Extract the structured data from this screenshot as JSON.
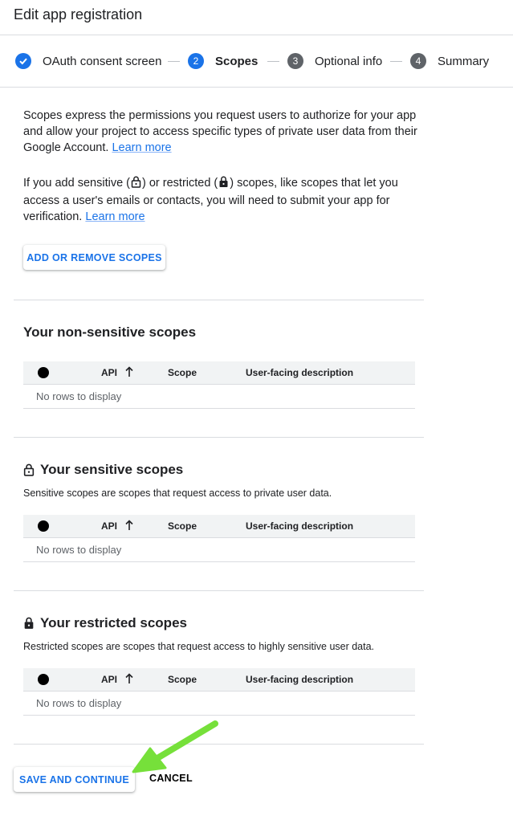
{
  "header": {
    "title": "Edit app registration"
  },
  "stepper": {
    "steps": [
      {
        "number": "",
        "label": "OAuth consent screen",
        "state": "done"
      },
      {
        "number": "2",
        "label": "Scopes",
        "state": "active"
      },
      {
        "number": "3",
        "label": "Optional info",
        "state": "pending"
      },
      {
        "number": "4",
        "label": "Summary",
        "state": "pending"
      }
    ]
  },
  "intro": {
    "text": "Scopes express the permissions you request users to authorize for your app and allow your project to access specific types of private user data from their Google Account.",
    "link": "Learn more"
  },
  "sensitive_note": {
    "text_a": "If you add sensitive (",
    "text_b": ") or restricted (",
    "text_c": ") scopes, like scopes that let you access a user's emails or contacts, you will need to submit your app for verification.",
    "link": "Learn more"
  },
  "add_scopes_button": "ADD OR REMOVE SCOPES",
  "table_columns": {
    "api": "API",
    "scope": "Scope",
    "description": "User-facing description"
  },
  "empty_text": "No rows to display",
  "sections": {
    "non_sensitive": {
      "title": "Your non-sensitive scopes"
    },
    "sensitive": {
      "title": "Your sensitive scopes",
      "subtitle": "Sensitive scopes are scopes that request access to private user data."
    },
    "restricted": {
      "title": "Your restricted scopes",
      "subtitle": "Restricted scopes are scopes that request access to highly sensitive user data."
    }
  },
  "footer": {
    "save_label": "SAVE AND CONTINUE",
    "cancel_label": "CANCEL"
  },
  "colors": {
    "accent": "#1a73e8",
    "step_pending": "#5f6368",
    "arrow": "#76e03a"
  }
}
